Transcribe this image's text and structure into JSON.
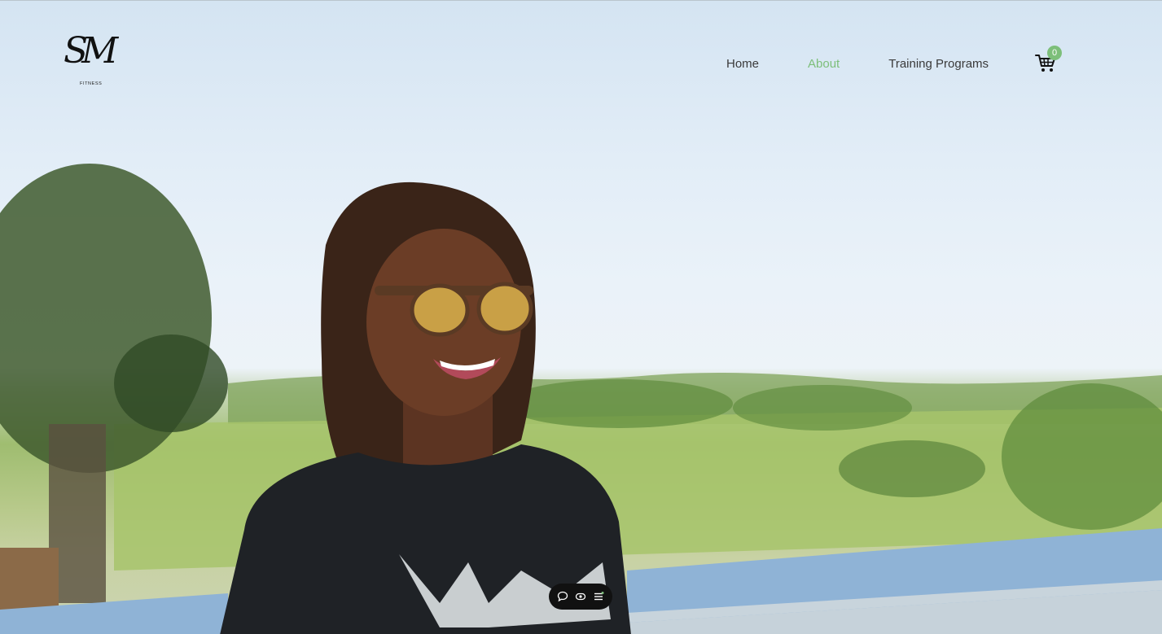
{
  "logo": {
    "monogram": "SM",
    "subtitle": "FITNESS"
  },
  "nav": {
    "items": [
      {
        "label": "Home",
        "active": false
      },
      {
        "label": "About",
        "active": true
      },
      {
        "label": "Training Programs",
        "active": false
      }
    ]
  },
  "cart": {
    "icon": "cart-icon",
    "count": "0"
  },
  "toolbar": {
    "icons": [
      "comment-icon",
      "preview-icon",
      "menu-icon"
    ]
  },
  "colors": {
    "accent": "#7dbf7a",
    "nav_text": "#3a3a3a",
    "sky": "#e3eef8"
  }
}
